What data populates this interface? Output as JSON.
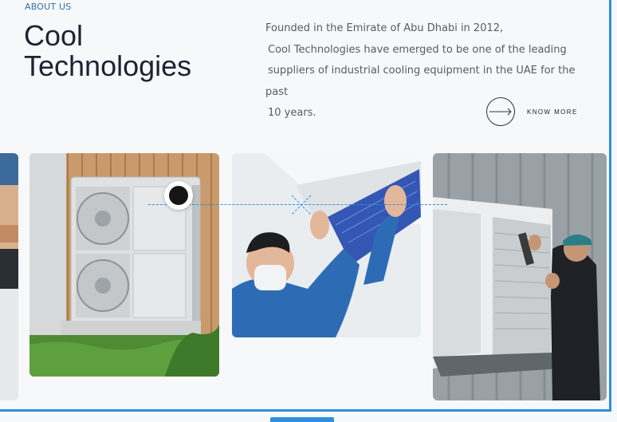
{
  "about": {
    "eyebrow": "ABOUT US",
    "title_line1": "Cool",
    "title_line2": "Technologies",
    "description_lines": [
      "Founded in the Emirate of Abu Dhabi in 2012,",
      "Cool Technologies have emerged to be one of the leading",
      "suppliers of industrial cooling equipment in the UAE for the past",
      "10 years."
    ]
  },
  "cta": {
    "label": "KNOW MORE",
    "icon": "arrow-right-icon"
  },
  "gallery": {
    "images": [
      {
        "name": "partial-hvac-image"
      },
      {
        "name": "outdoor-heat-pump-image"
      },
      {
        "name": "technician-cleaning-ac-filter-image"
      },
      {
        "name": "technician-servicing-outdoor-unit-image"
      }
    ]
  },
  "colors": {
    "accent": "#2d8fdf",
    "eyebrow": "#2f6fb0",
    "heading": "#1c2433",
    "body_text": "#555b66",
    "background": "#f7f8fa"
  }
}
